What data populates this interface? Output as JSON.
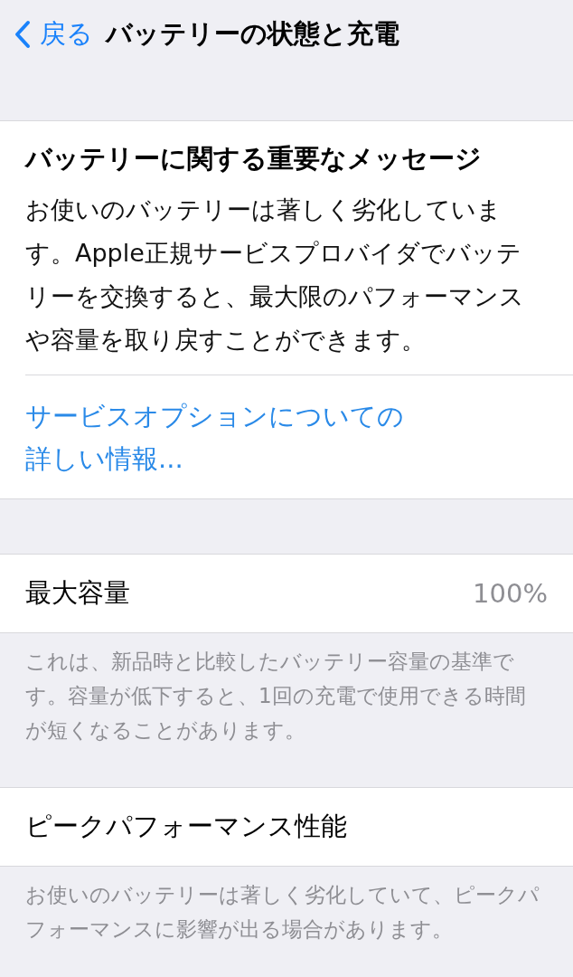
{
  "nav": {
    "back": "戻る",
    "title": "バッテリーの状態と充電"
  },
  "message": {
    "heading": "バッテリーに関する重要なメッセージ",
    "body": "お使いのバッテリーは著しく劣化しています。Apple正規サービスプロバイダでバッテリーを交換すると、最大限のパフォーマンスや容量を取り戻すことができます。",
    "link": "サービスオプションについての詳しい情報..."
  },
  "sections": [
    {
      "label": "最大容量",
      "value": "100%",
      "footer": "これは、新品時と比較したバッテリー容量の基準です。容量が低下すると、1回の充電で使用できる時間が短くなることがあります。"
    },
    {
      "label": "ピークパフォーマンス性能",
      "footer": "お使いのバッテリーは著しく劣化していて、ピークパフォーマンスに影響が出る場合があります。"
    }
  ]
}
